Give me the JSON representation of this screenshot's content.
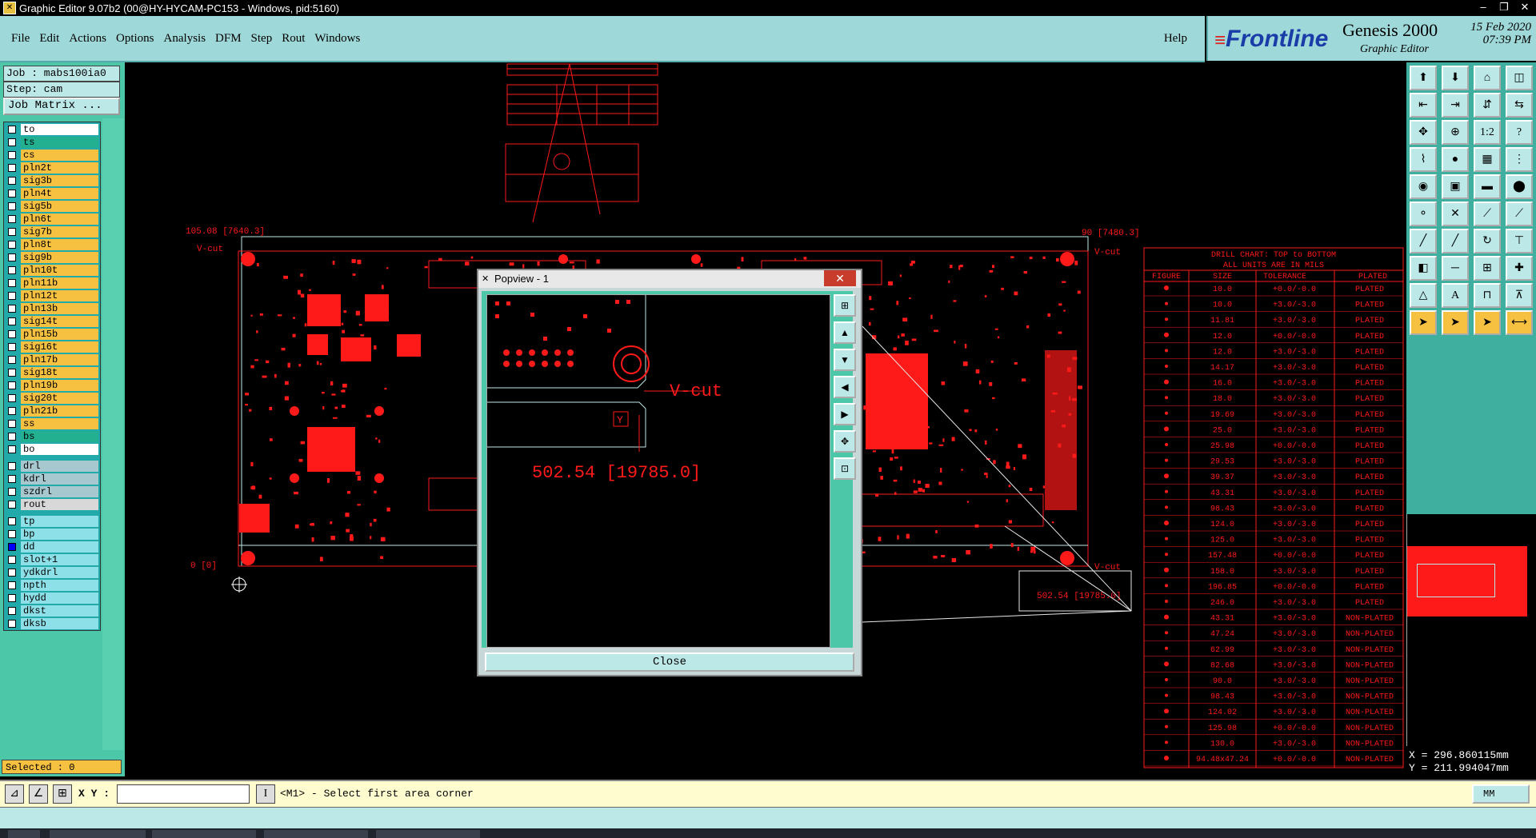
{
  "window": {
    "title": "Graphic Editor 9.07b2 (00@HY-HYCAM-PC153 - Windows, pid:5160)"
  },
  "menu": {
    "items": [
      "File",
      "Edit",
      "Actions",
      "Options",
      "Analysis",
      "DFM",
      "Step",
      "Rout",
      "Windows"
    ],
    "help": "Help"
  },
  "brand": {
    "logo": "Frontline",
    "product": "Genesis 2000",
    "subtitle": "Graphic Editor",
    "date": "15 Feb 2020",
    "time": "07:39 PM"
  },
  "job": {
    "job_line": "Job : mabs100ia0",
    "step_line": "Step: cam",
    "matrix_button": "Job Matrix ..."
  },
  "layers": [
    {
      "name": "to",
      "color": "#ffffff",
      "gap": false
    },
    {
      "name": "ts",
      "color": "#22b090",
      "gap": false
    },
    {
      "name": "cs",
      "color": "#f6c040",
      "gap": false
    },
    {
      "name": "pln2t",
      "color": "#f6c040",
      "gap": false
    },
    {
      "name": "sig3b",
      "color": "#f6c040",
      "gap": false
    },
    {
      "name": "pln4t",
      "color": "#f6c040",
      "gap": false
    },
    {
      "name": "sig5b",
      "color": "#f6c040",
      "gap": false
    },
    {
      "name": "pln6t",
      "color": "#f6c040",
      "gap": false
    },
    {
      "name": "sig7b",
      "color": "#f6c040",
      "gap": false
    },
    {
      "name": "pln8t",
      "color": "#f6c040",
      "gap": false
    },
    {
      "name": "sig9b",
      "color": "#f6c040",
      "gap": false
    },
    {
      "name": "pln10t",
      "color": "#f6c040",
      "gap": false
    },
    {
      "name": "pln11b",
      "color": "#f6c040",
      "gap": false
    },
    {
      "name": "pln12t",
      "color": "#f6c040",
      "gap": false
    },
    {
      "name": "pln13b",
      "color": "#f6c040",
      "gap": false
    },
    {
      "name": "sig14t",
      "color": "#f6c040",
      "gap": false
    },
    {
      "name": "pln15b",
      "color": "#f6c040",
      "gap": false
    },
    {
      "name": "sig16t",
      "color": "#f6c040",
      "gap": false
    },
    {
      "name": "pln17b",
      "color": "#f6c040",
      "gap": false
    },
    {
      "name": "sig18t",
      "color": "#f6c040",
      "gap": false
    },
    {
      "name": "pln19b",
      "color": "#f6c040",
      "gap": false
    },
    {
      "name": "sig20t",
      "color": "#f6c040",
      "gap": false
    },
    {
      "name": "pln21b",
      "color": "#f6c040",
      "gap": false
    },
    {
      "name": "ss",
      "color": "#f6c040",
      "gap": false
    },
    {
      "name": "bs",
      "color": "#22b090",
      "gap": false
    },
    {
      "name": "bo",
      "color": "#ffffff",
      "gap": false
    },
    {
      "name": "drl",
      "color": "#a8c8d0",
      "gap": true
    },
    {
      "name": "kdrl",
      "color": "#a8c8d0",
      "gap": false
    },
    {
      "name": "szdrl",
      "color": "#a8c8d0",
      "gap": false
    },
    {
      "name": "rout",
      "color": "#d8d8d8",
      "gap": false
    },
    {
      "name": "tp",
      "color": "#8ee0e8",
      "gap": true
    },
    {
      "name": "bp",
      "color": "#8ee0e8",
      "gap": false
    },
    {
      "name": "dd",
      "color": "#8ee0e8",
      "gap": false,
      "selected": true
    },
    {
      "name": "slot+1",
      "color": "#8ee0e8",
      "gap": false
    },
    {
      "name": "ydkdrl",
      "color": "#8ee0e8",
      "gap": false
    },
    {
      "name": "npth",
      "color": "#8ee0e8",
      "gap": false
    },
    {
      "name": "hydd",
      "color": "#8ee0e8",
      "gap": false
    },
    {
      "name": "dkst",
      "color": "#8ee0e8",
      "gap": false
    },
    {
      "name": "dksb",
      "color": "#8ee0e8",
      "gap": false
    }
  ],
  "selected_text": "Selected : 0",
  "canvas": {
    "dim_left": "105.08 [7640.3]",
    "dim_right": "90 [7480.3]",
    "vcut": "V-cut",
    "zero": "0 [0]",
    "dim_bottom": "502.54 [19785.0]"
  },
  "drill_chart": {
    "title": "DRILL CHART: TOP to BOTTOM",
    "subtitle": "ALL UNITS ARE IN MILS",
    "headers": [
      "FIGURE",
      "SIZE",
      "TOLERANCE",
      "PLATED"
    ],
    "rows": [
      [
        "10.0",
        "+0.0/-0.0",
        "PLATED"
      ],
      [
        "10.0",
        "+3.0/-3.0",
        "PLATED"
      ],
      [
        "11.81",
        "+3.0/-3.0",
        "PLATED"
      ],
      [
        "12.0",
        "+0.0/-0.0",
        "PLATED"
      ],
      [
        "12.0",
        "+3.0/-3.0",
        "PLATED"
      ],
      [
        "14.17",
        "+3.0/-3.0",
        "PLATED"
      ],
      [
        "16.0",
        "+3.0/-3.0",
        "PLATED"
      ],
      [
        "18.0",
        "+3.0/-3.0",
        "PLATED"
      ],
      [
        "19.69",
        "+3.0/-3.0",
        "PLATED"
      ],
      [
        "25.0",
        "+3.0/-3.0",
        "PLATED"
      ],
      [
        "25.98",
        "+0.0/-0.0",
        "PLATED"
      ],
      [
        "29.53",
        "+3.0/-3.0",
        "PLATED"
      ],
      [
        "39.37",
        "+3.0/-3.0",
        "PLATED"
      ],
      [
        "43.31",
        "+3.0/-3.0",
        "PLATED"
      ],
      [
        "98.43",
        "+3.0/-3.0",
        "PLATED"
      ],
      [
        "124.0",
        "+3.0/-3.0",
        "PLATED"
      ],
      [
        "125.0",
        "+3.0/-3.0",
        "PLATED"
      ],
      [
        "157.48",
        "+0.0/-0.0",
        "PLATED"
      ],
      [
        "158.0",
        "+3.0/-3.0",
        "PLATED"
      ],
      [
        "196.85",
        "+0.0/-0.0",
        "PLATED"
      ],
      [
        "246.0",
        "+3.0/-3.0",
        "PLATED"
      ],
      [
        "43.31",
        "+3.0/-3.0",
        "NON-PLATED"
      ],
      [
        "47.24",
        "+3.0/-3.0",
        "NON-PLATED"
      ],
      [
        "62.99",
        "+3.0/-3.0",
        "NON-PLATED"
      ],
      [
        "82.68",
        "+3.0/-3.0",
        "NON-PLATED"
      ],
      [
        "90.0",
        "+3.0/-3.0",
        "NON-PLATED"
      ],
      [
        "98.43",
        "+3.0/-3.0",
        "NON-PLATED"
      ],
      [
        "124.02",
        "+3.0/-3.0",
        "NON-PLATED"
      ],
      [
        "125.98",
        "+0.0/-0.0",
        "NON-PLATED"
      ],
      [
        "130.0",
        "+3.0/-3.0",
        "NON-PLATED"
      ],
      [
        "94.48x47.24",
        "+0.0/-0.0",
        "NON-PLATED"
      ]
    ]
  },
  "popview": {
    "title": "Popview - 1",
    "close_label": "Close",
    "vcut": "V-cut",
    "marker": "Y",
    "dimension": "502.54 [19785.0]"
  },
  "coords": {
    "x": "X = 296.860115mm",
    "y": "Y = 211.994047mm"
  },
  "bottom": {
    "xy_label": "X Y :",
    "xy_value": "",
    "message": "<M1> - Select first area corner",
    "units": "MM"
  },
  "colors": {
    "accent": "#9fd8d8",
    "panel": "#4cc8a8",
    "cad_red": "#ff1a1a",
    "outline": "#c0e8e8"
  },
  "icons": [
    "open-icon",
    "save-icon",
    "home-icon",
    "layout-icon",
    "zoom-fit-icon",
    "ratio-icon",
    "help-icon",
    "select-arrow-icon",
    "line-icon",
    "arc-icon",
    "pad-icon",
    "measure-icon"
  ]
}
